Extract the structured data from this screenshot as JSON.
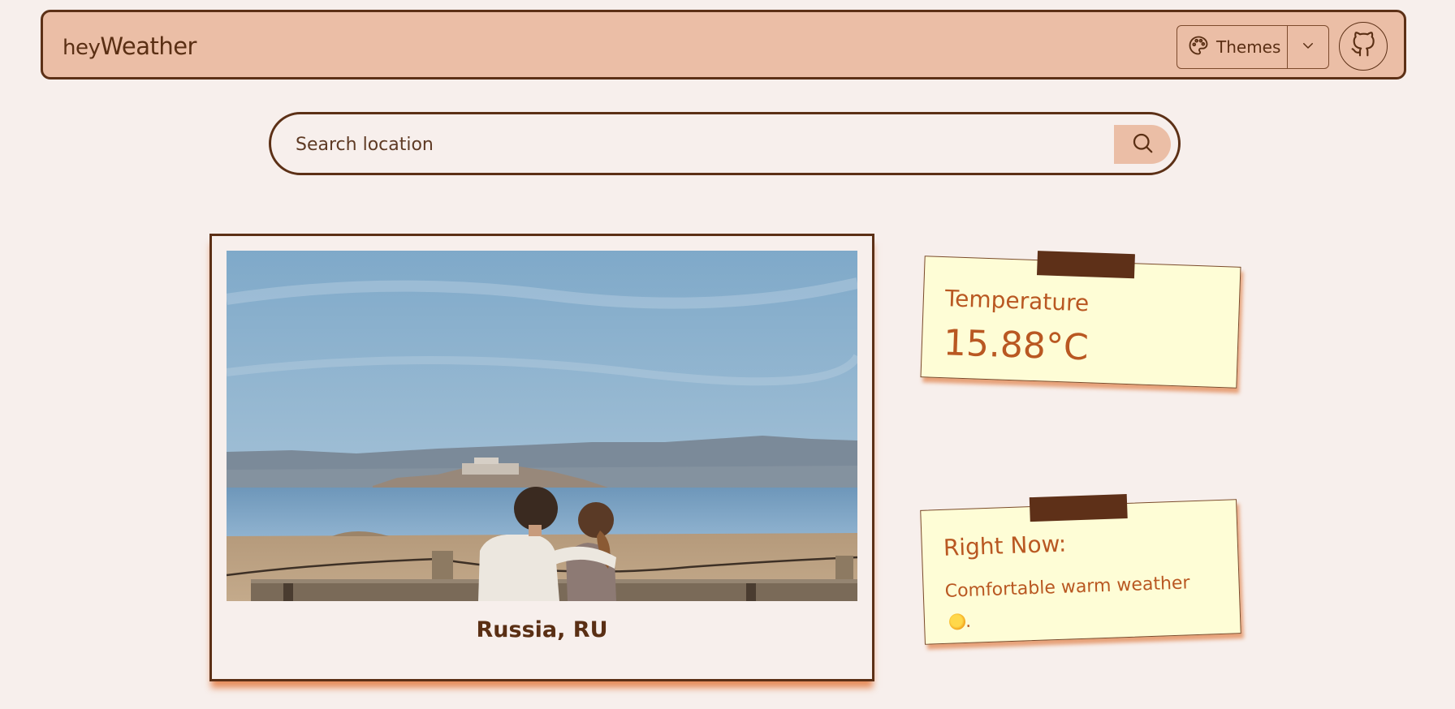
{
  "header": {
    "brand_light": "hey",
    "brand_strong": "Weather",
    "themes_label": "Themes",
    "icons": {
      "palette": "palette-icon",
      "chevron": "chevron-down-icon",
      "github": "github-icon"
    }
  },
  "search": {
    "placeholder": "Search location",
    "value": "",
    "icon": "search-icon"
  },
  "photo_card": {
    "location": "Russia, RU",
    "image_description_icon": "scenic-photo"
  },
  "notes": {
    "temperature": {
      "title": "Temperature",
      "value": "15.88°C"
    },
    "right_now": {
      "title": "Right Now:",
      "description": "Comfortable warm weather",
      "emoji_icon": "sun-icon",
      "suffix": "."
    }
  },
  "colors": {
    "background": "#f7efec",
    "accent": "#ebbea6",
    "border": "#5c3016",
    "note_bg": "#fefdd6",
    "note_text": "#b95822"
  }
}
